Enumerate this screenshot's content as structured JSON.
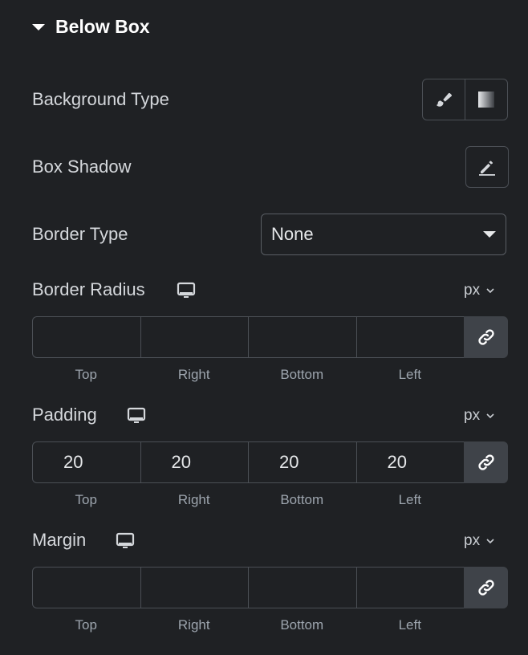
{
  "section": {
    "title": "Below Box",
    "expanded": true
  },
  "background_type": {
    "label": "Background Type",
    "options": [
      {
        "icon": "brush-icon",
        "name": "Classic"
      },
      {
        "icon": "gradient-icon",
        "name": "Gradient"
      }
    ]
  },
  "box_shadow": {
    "label": "Box Shadow",
    "icon": "pencil-icon"
  },
  "border_type": {
    "label": "Border Type",
    "value": "None"
  },
  "border_radius": {
    "label": "Border Radius",
    "device_icon": "desktop-icon",
    "unit": "px",
    "values": [
      "",
      "",
      "",
      ""
    ],
    "sides": [
      "Top",
      "Right",
      "Bottom",
      "Left"
    ],
    "linked": true
  },
  "padding": {
    "label": "Padding",
    "device_icon": "desktop-icon",
    "unit": "px",
    "values": [
      "20",
      "20",
      "20",
      "20"
    ],
    "sides": [
      "Top",
      "Right",
      "Bottom",
      "Left"
    ],
    "linked": true
  },
  "margin": {
    "label": "Margin",
    "device_icon": "desktop-icon",
    "unit": "px",
    "values": [
      "",
      "",
      "",
      ""
    ],
    "sides": [
      "Top",
      "Right",
      "Bottom",
      "Left"
    ],
    "linked": true
  }
}
